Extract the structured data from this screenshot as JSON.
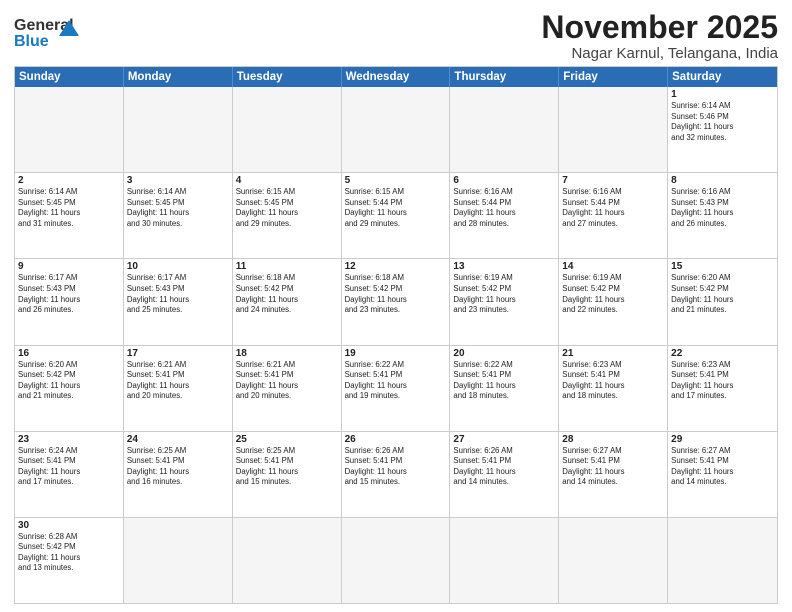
{
  "header": {
    "logo_general": "General",
    "logo_blue": "Blue",
    "month_title": "November 2025",
    "location": "Nagar Karnul, Telangana, India"
  },
  "days": [
    "Sunday",
    "Monday",
    "Tuesday",
    "Wednesday",
    "Thursday",
    "Friday",
    "Saturday"
  ],
  "weeks": [
    [
      {
        "date": "",
        "info": ""
      },
      {
        "date": "",
        "info": ""
      },
      {
        "date": "",
        "info": ""
      },
      {
        "date": "",
        "info": ""
      },
      {
        "date": "",
        "info": ""
      },
      {
        "date": "",
        "info": ""
      },
      {
        "date": "1",
        "info": "Sunrise: 6:14 AM\nSunset: 5:46 PM\nDaylight: 11 hours\nand 32 minutes."
      }
    ],
    [
      {
        "date": "2",
        "info": "Sunrise: 6:14 AM\nSunset: 5:45 PM\nDaylight: 11 hours\nand 31 minutes."
      },
      {
        "date": "3",
        "info": "Sunrise: 6:14 AM\nSunset: 5:45 PM\nDaylight: 11 hours\nand 30 minutes."
      },
      {
        "date": "4",
        "info": "Sunrise: 6:15 AM\nSunset: 5:45 PM\nDaylight: 11 hours\nand 29 minutes."
      },
      {
        "date": "5",
        "info": "Sunrise: 6:15 AM\nSunset: 5:44 PM\nDaylight: 11 hours\nand 29 minutes."
      },
      {
        "date": "6",
        "info": "Sunrise: 6:16 AM\nSunset: 5:44 PM\nDaylight: 11 hours\nand 28 minutes."
      },
      {
        "date": "7",
        "info": "Sunrise: 6:16 AM\nSunset: 5:44 PM\nDaylight: 11 hours\nand 27 minutes."
      },
      {
        "date": "8",
        "info": "Sunrise: 6:16 AM\nSunset: 5:43 PM\nDaylight: 11 hours\nand 26 minutes."
      }
    ],
    [
      {
        "date": "9",
        "info": "Sunrise: 6:17 AM\nSunset: 5:43 PM\nDaylight: 11 hours\nand 26 minutes."
      },
      {
        "date": "10",
        "info": "Sunrise: 6:17 AM\nSunset: 5:43 PM\nDaylight: 11 hours\nand 25 minutes."
      },
      {
        "date": "11",
        "info": "Sunrise: 6:18 AM\nSunset: 5:42 PM\nDaylight: 11 hours\nand 24 minutes."
      },
      {
        "date": "12",
        "info": "Sunrise: 6:18 AM\nSunset: 5:42 PM\nDaylight: 11 hours\nand 23 minutes."
      },
      {
        "date": "13",
        "info": "Sunrise: 6:19 AM\nSunset: 5:42 PM\nDaylight: 11 hours\nand 23 minutes."
      },
      {
        "date": "14",
        "info": "Sunrise: 6:19 AM\nSunset: 5:42 PM\nDaylight: 11 hours\nand 22 minutes."
      },
      {
        "date": "15",
        "info": "Sunrise: 6:20 AM\nSunset: 5:42 PM\nDaylight: 11 hours\nand 21 minutes."
      }
    ],
    [
      {
        "date": "16",
        "info": "Sunrise: 6:20 AM\nSunset: 5:42 PM\nDaylight: 11 hours\nand 21 minutes."
      },
      {
        "date": "17",
        "info": "Sunrise: 6:21 AM\nSunset: 5:41 PM\nDaylight: 11 hours\nand 20 minutes."
      },
      {
        "date": "18",
        "info": "Sunrise: 6:21 AM\nSunset: 5:41 PM\nDaylight: 11 hours\nand 20 minutes."
      },
      {
        "date": "19",
        "info": "Sunrise: 6:22 AM\nSunset: 5:41 PM\nDaylight: 11 hours\nand 19 minutes."
      },
      {
        "date": "20",
        "info": "Sunrise: 6:22 AM\nSunset: 5:41 PM\nDaylight: 11 hours\nand 18 minutes."
      },
      {
        "date": "21",
        "info": "Sunrise: 6:23 AM\nSunset: 5:41 PM\nDaylight: 11 hours\nand 18 minutes."
      },
      {
        "date": "22",
        "info": "Sunrise: 6:23 AM\nSunset: 5:41 PM\nDaylight: 11 hours\nand 17 minutes."
      }
    ],
    [
      {
        "date": "23",
        "info": "Sunrise: 6:24 AM\nSunset: 5:41 PM\nDaylight: 11 hours\nand 17 minutes."
      },
      {
        "date": "24",
        "info": "Sunrise: 6:25 AM\nSunset: 5:41 PM\nDaylight: 11 hours\nand 16 minutes."
      },
      {
        "date": "25",
        "info": "Sunrise: 6:25 AM\nSunset: 5:41 PM\nDaylight: 11 hours\nand 15 minutes."
      },
      {
        "date": "26",
        "info": "Sunrise: 6:26 AM\nSunset: 5:41 PM\nDaylight: 11 hours\nand 15 minutes."
      },
      {
        "date": "27",
        "info": "Sunrise: 6:26 AM\nSunset: 5:41 PM\nDaylight: 11 hours\nand 14 minutes."
      },
      {
        "date": "28",
        "info": "Sunrise: 6:27 AM\nSunset: 5:41 PM\nDaylight: 11 hours\nand 14 minutes."
      },
      {
        "date": "29",
        "info": "Sunrise: 6:27 AM\nSunset: 5:41 PM\nDaylight: 11 hours\nand 14 minutes."
      }
    ],
    [
      {
        "date": "30",
        "info": "Sunrise: 6:28 AM\nSunset: 5:42 PM\nDaylight: 11 hours\nand 13 minutes."
      },
      {
        "date": "",
        "info": ""
      },
      {
        "date": "",
        "info": ""
      },
      {
        "date": "",
        "info": ""
      },
      {
        "date": "",
        "info": ""
      },
      {
        "date": "",
        "info": ""
      },
      {
        "date": "",
        "info": ""
      }
    ]
  ]
}
